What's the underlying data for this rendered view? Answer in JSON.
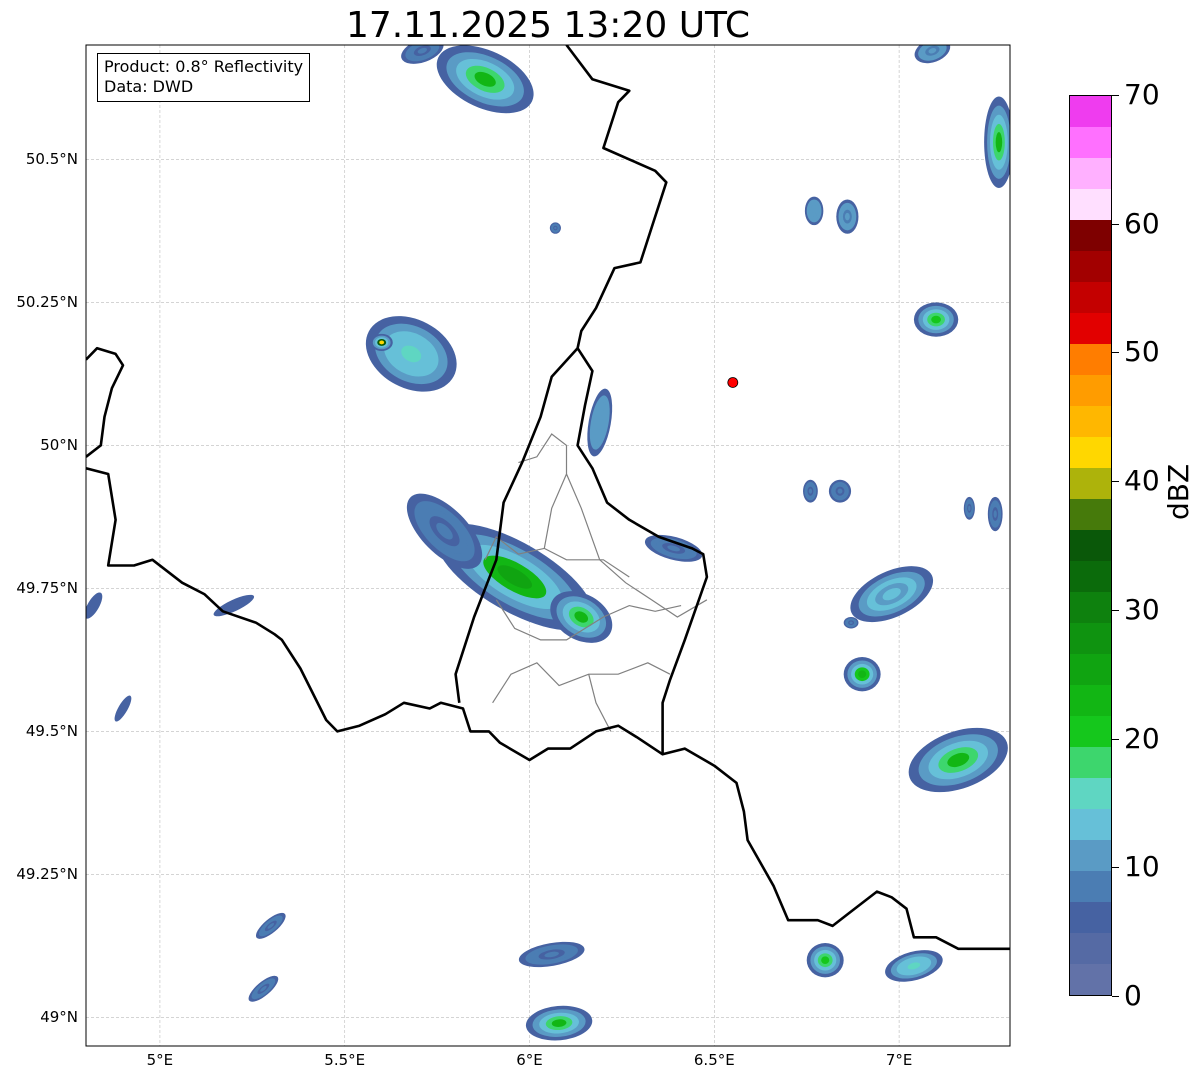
{
  "title": "17.11.2025 13:20 UTC",
  "info": {
    "product": "Product: 0.8° Reflectivity",
    "data": "Data: DWD"
  },
  "axes": {
    "lon_range": [
      4.8,
      7.3
    ],
    "lat_range": [
      48.95,
      50.7
    ],
    "x_ticks": [
      "5°E",
      "5.5°E",
      "6°E",
      "6.5°E",
      "7°E"
    ],
    "y_ticks": [
      "50.5°N",
      "50.25°N",
      "50°N",
      "49.75°N",
      "49.5°N",
      "49.25°N",
      "49°N"
    ],
    "grid": true
  },
  "colorbar": {
    "label": "dBZ",
    "range": [
      0,
      70
    ],
    "ticks": [
      "0",
      "10",
      "20",
      "30",
      "40",
      "50",
      "60",
      "70"
    ],
    "colors": [
      "#6272a8",
      "#556aa4",
      "#4662a2",
      "#4b7db3",
      "#5a9bc5",
      "#66c0d8",
      "#5fd6c2",
      "#3dd66d",
      "#15c71c",
      "#12b614",
      "#10a411",
      "#0f9310",
      "#0e810e",
      "#0b6b0b",
      "#0a5809",
      "#467a0b",
      "#adb30b",
      "#ffd700",
      "#ffb700",
      "#ff9c00",
      "#ff7d00",
      "#e20000",
      "#c40000",
      "#a20000",
      "#7e0000",
      "#ffdfff",
      "#ffb0ff",
      "#ff70ff",
      "#ef3cef"
    ]
  },
  "radar_marker": {
    "lon": 6.55,
    "lat": 50.11,
    "color": "#ff0000"
  },
  "echoes": [
    {
      "lon": 5.88,
      "lat": 50.64,
      "rx": 0.14,
      "ry": 0.05,
      "rot": 25,
      "dbz": 22
    },
    {
      "lon": 5.71,
      "lat": 50.69,
      "rx": 0.06,
      "ry": 0.02,
      "rot": -20,
      "dbz": 8
    },
    {
      "lon": 5.68,
      "lat": 50.16,
      "rx": 0.13,
      "ry": 0.06,
      "rot": 28,
      "dbz": 16
    },
    {
      "lon": 5.6,
      "lat": 50.18,
      "rx": 0.03,
      "ry": 0.015,
      "rot": 0,
      "dbz": 42
    },
    {
      "lon": 6.19,
      "lat": 50.04,
      "rx": 0.03,
      "ry": 0.06,
      "rot": 10,
      "dbz": 12
    },
    {
      "lon": 5.96,
      "lat": 49.77,
      "rx": 0.24,
      "ry": 0.06,
      "rot": 30,
      "dbz": 26
    },
    {
      "lon": 5.77,
      "lat": 49.85,
      "rx": 0.13,
      "ry": 0.04,
      "rot": 45,
      "dbz": 8
    },
    {
      "lon": 6.14,
      "lat": 49.7,
      "rx": 0.09,
      "ry": 0.04,
      "rot": 30,
      "dbz": 22
    },
    {
      "lon": 6.39,
      "lat": 49.82,
      "rx": 0.08,
      "ry": 0.02,
      "rot": 15,
      "dbz": 8
    },
    {
      "lon": 6.86,
      "lat": 50.4,
      "rx": 0.03,
      "ry": 0.03,
      "rot": 0,
      "dbz": 10
    },
    {
      "lon": 6.77,
      "lat": 50.41,
      "rx": 0.025,
      "ry": 0.025,
      "rot": 0,
      "dbz": 12
    },
    {
      "lon": 7.1,
      "lat": 50.22,
      "rx": 0.06,
      "ry": 0.03,
      "rot": 0,
      "dbz": 20
    },
    {
      "lon": 7.27,
      "lat": 50.53,
      "rx": 0.04,
      "ry": 0.08,
      "rot": 0,
      "dbz": 22
    },
    {
      "lon": 7.09,
      "lat": 50.69,
      "rx": 0.05,
      "ry": 0.02,
      "rot": -20,
      "dbz": 10
    },
    {
      "lon": 6.98,
      "lat": 49.74,
      "rx": 0.12,
      "ry": 0.04,
      "rot": -25,
      "dbz": 14
    },
    {
      "lon": 6.9,
      "lat": 49.6,
      "rx": 0.05,
      "ry": 0.03,
      "rot": 0,
      "dbz": 24
    },
    {
      "lon": 7.16,
      "lat": 49.45,
      "rx": 0.14,
      "ry": 0.05,
      "rot": -20,
      "dbz": 22
    },
    {
      "lon": 6.84,
      "lat": 49.92,
      "rx": 0.03,
      "ry": 0.02,
      "rot": 0,
      "dbz": 8
    },
    {
      "lon": 6.76,
      "lat": 49.92,
      "rx": 0.02,
      "ry": 0.02,
      "rot": 0,
      "dbz": 8
    },
    {
      "lon": 6.06,
      "lat": 49.11,
      "rx": 0.09,
      "ry": 0.02,
      "rot": -10,
      "dbz": 8
    },
    {
      "lon": 6.08,
      "lat": 48.99,
      "rx": 0.09,
      "ry": 0.03,
      "rot": -5,
      "dbz": 22
    },
    {
      "lon": 6.8,
      "lat": 49.1,
      "rx": 0.05,
      "ry": 0.03,
      "rot": 0,
      "dbz": 20
    },
    {
      "lon": 7.04,
      "lat": 49.09,
      "rx": 0.08,
      "ry": 0.025,
      "rot": -15,
      "dbz": 16
    },
    {
      "lon": 5.3,
      "lat": 49.16,
      "rx": 0.05,
      "ry": 0.012,
      "rot": -40,
      "dbz": 8
    },
    {
      "lon": 5.28,
      "lat": 49.05,
      "rx": 0.05,
      "ry": 0.012,
      "rot": -40,
      "dbz": 8
    },
    {
      "lon": 4.82,
      "lat": 49.72,
      "rx": 0.04,
      "ry": 0.01,
      "rot": -60,
      "dbz": 6
    },
    {
      "lon": 4.9,
      "lat": 49.54,
      "rx": 0.04,
      "ry": 0.008,
      "rot": -60,
      "dbz": 6
    },
    {
      "lon": 5.2,
      "lat": 49.72,
      "rx": 0.06,
      "ry": 0.01,
      "rot": -25,
      "dbz": 6
    },
    {
      "lon": 7.26,
      "lat": 49.88,
      "rx": 0.02,
      "ry": 0.03,
      "rot": 0,
      "dbz": 8
    },
    {
      "lon": 7.19,
      "lat": 49.89,
      "rx": 0.015,
      "ry": 0.02,
      "rot": 0,
      "dbz": 8
    },
    {
      "lon": 6.87,
      "lat": 49.69,
      "rx": 0.02,
      "ry": 0.01,
      "rot": 0,
      "dbz": 8
    },
    {
      "lon": 6.07,
      "lat": 50.38,
      "rx": 0.015,
      "ry": 0.01,
      "rot": 0,
      "dbz": 8
    }
  ],
  "borders": {
    "national": [
      [
        [
          4.8,
          50.15
        ],
        [
          4.83,
          50.17
        ],
        [
          4.88,
          50.16
        ],
        [
          4.9,
          50.14
        ],
        [
          4.87,
          50.1
        ],
        [
          4.85,
          50.05
        ],
        [
          4.84,
          50.0
        ],
        [
          4.8,
          49.98
        ]
      ],
      [
        [
          4.8,
          49.96
        ],
        [
          4.86,
          49.95
        ],
        [
          4.88,
          49.87
        ],
        [
          4.86,
          49.79
        ],
        [
          4.93,
          49.79
        ],
        [
          4.98,
          49.8
        ],
        [
          5.06,
          49.76
        ],
        [
          5.12,
          49.74
        ],
        [
          5.17,
          49.71
        ],
        [
          5.26,
          49.69
        ],
        [
          5.31,
          49.67
        ],
        [
          5.33,
          49.66
        ],
        [
          5.38,
          49.61
        ],
        [
          5.45,
          49.52
        ],
        [
          5.48,
          49.5
        ],
        [
          5.54,
          49.51
        ],
        [
          5.61,
          49.53
        ],
        [
          5.66,
          49.55
        ],
        [
          5.73,
          49.54
        ],
        [
          5.76,
          49.55
        ],
        [
          5.82,
          49.54
        ],
        [
          5.84,
          49.5
        ],
        [
          5.89,
          49.5
        ],
        [
          5.92,
          49.48
        ],
        [
          6.0,
          49.45
        ],
        [
          6.05,
          49.47
        ],
        [
          6.11,
          49.47
        ],
        [
          6.18,
          49.5
        ],
        [
          6.24,
          49.51
        ],
        [
          6.29,
          49.49
        ],
        [
          6.36,
          49.46
        ],
        [
          6.42,
          49.47
        ],
        [
          6.5,
          49.44
        ],
        [
          6.56,
          49.41
        ],
        [
          6.58,
          49.36
        ],
        [
          6.59,
          49.31
        ],
        [
          6.66,
          49.23
        ],
        [
          6.7,
          49.17
        ],
        [
          6.78,
          49.17
        ],
        [
          6.82,
          49.16
        ],
        [
          6.86,
          49.18
        ],
        [
          6.94,
          49.22
        ],
        [
          6.98,
          49.21
        ],
        [
          7.02,
          49.19
        ],
        [
          7.04,
          49.14
        ],
        [
          7.1,
          49.14
        ],
        [
          7.16,
          49.12
        ],
        [
          7.23,
          49.12
        ],
        [
          7.3,
          49.12
        ]
      ],
      [
        [
          5.81,
          49.55
        ],
        [
          5.8,
          49.6
        ],
        [
          5.85,
          49.7
        ],
        [
          5.91,
          49.8
        ],
        [
          5.93,
          49.9
        ],
        [
          5.98,
          49.97
        ],
        [
          6.03,
          50.05
        ],
        [
          6.06,
          50.12
        ],
        [
          6.13,
          50.17
        ],
        [
          6.17,
          50.13
        ],
        [
          6.15,
          50.07
        ],
        [
          6.13,
          50.0
        ],
        [
          6.17,
          49.96
        ],
        [
          6.21,
          49.9
        ],
        [
          6.27,
          49.87
        ],
        [
          6.35,
          49.84
        ],
        [
          6.44,
          49.82
        ],
        [
          6.47,
          49.81
        ],
        [
          6.48,
          49.77
        ],
        [
          6.42,
          49.66
        ],
        [
          6.38,
          49.59
        ],
        [
          6.36,
          49.55
        ],
        [
          6.36,
          49.46
        ]
      ],
      [
        [
          6.13,
          50.17
        ],
        [
          6.14,
          50.2
        ],
        [
          6.18,
          50.24
        ],
        [
          6.23,
          50.31
        ],
        [
          6.3,
          50.32
        ],
        [
          6.33,
          50.38
        ],
        [
          6.37,
          50.46
        ],
        [
          6.34,
          50.48
        ],
        [
          6.27,
          50.5
        ],
        [
          6.2,
          50.52
        ],
        [
          6.24,
          50.6
        ],
        [
          6.27,
          50.62
        ],
        [
          6.17,
          50.64
        ],
        [
          6.1,
          50.7
        ]
      ]
    ],
    "regional": [
      [
        [
          5.97,
          49.97
        ],
        [
          6.02,
          49.98
        ],
        [
          6.06,
          50.02
        ],
        [
          6.1,
          50.0
        ],
        [
          6.1,
          49.95
        ],
        [
          6.06,
          49.89
        ],
        [
          6.04,
          49.82
        ],
        [
          5.97,
          49.81
        ],
        [
          5.91,
          49.84
        ],
        [
          5.88,
          49.8
        ]
      ],
      [
        [
          6.1,
          49.95
        ],
        [
          6.14,
          49.89
        ],
        [
          6.19,
          49.8
        ],
        [
          6.26,
          49.76
        ],
        [
          6.33,
          49.73
        ],
        [
          6.4,
          49.7
        ],
        [
          6.48,
          49.73
        ]
      ],
      [
        [
          6.04,
          49.82
        ],
        [
          6.1,
          49.8
        ],
        [
          6.2,
          49.8
        ],
        [
          6.27,
          49.77
        ]
      ],
      [
        [
          5.91,
          49.73
        ],
        [
          5.96,
          49.68
        ],
        [
          6.03,
          49.66
        ],
        [
          6.1,
          49.66
        ],
        [
          6.2,
          49.7
        ],
        [
          6.27,
          49.72
        ],
        [
          6.34,
          49.71
        ],
        [
          6.41,
          49.72
        ]
      ],
      [
        [
          5.9,
          49.55
        ],
        [
          5.95,
          49.6
        ],
        [
          6.02,
          49.62
        ],
        [
          6.08,
          49.58
        ],
        [
          6.16,
          49.6
        ],
        [
          6.24,
          49.6
        ],
        [
          6.32,
          49.62
        ],
        [
          6.38,
          49.6
        ]
      ],
      [
        [
          6.16,
          49.6
        ],
        [
          6.18,
          49.55
        ],
        [
          6.22,
          49.5
        ]
      ]
    ]
  }
}
